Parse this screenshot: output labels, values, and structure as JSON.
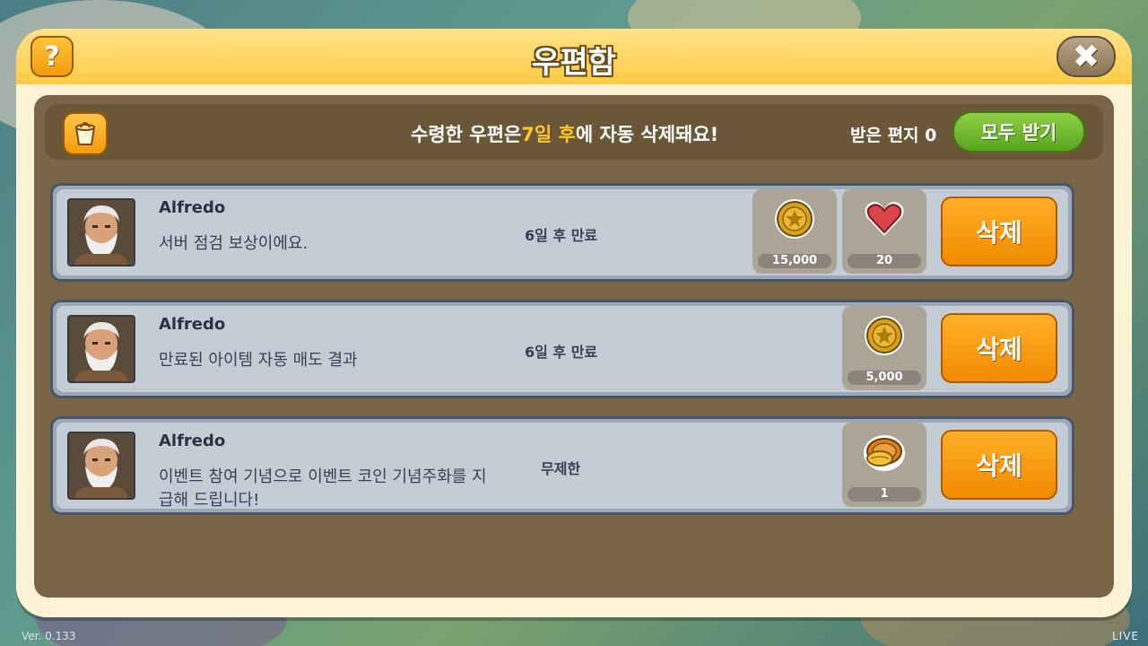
{
  "app": {
    "version": "Ver. 0.133",
    "live": "LIVE"
  },
  "dialog": {
    "title": "우편함",
    "help_icon": "?",
    "close_icon": "✖"
  },
  "notice": {
    "text_before": "수령한 우편은",
    "text_highlight": "7일 후",
    "text_after": "에 자동 삭제돼요!",
    "received_label": "받은 편지 0",
    "receive_all_label": "모두 받기"
  },
  "mails": [
    {
      "sender": "Alfredo",
      "message": "서버 점검 보상이에요.",
      "expire": "6일 후 만료",
      "rewards": [
        {
          "icon": "gold-coin-icon",
          "qty": "15,000"
        },
        {
          "icon": "heart-icon",
          "qty": "20"
        }
      ],
      "delete_label": "삭제"
    },
    {
      "sender": "Alfredo",
      "message": "만료된 아이템 자동 매도 결과",
      "expire": "6일 후 만료",
      "rewards": [
        {
          "icon": "gold-coin-icon",
          "qty": "5,000"
        }
      ],
      "delete_label": "삭제"
    },
    {
      "sender": "Alfredo",
      "message": "이벤트 참여 기념으로 이벤트 코인 기념주화를 지급해 드립니다!",
      "expire": "무제한",
      "rewards": [
        {
          "icon": "event-coin-icon",
          "qty": "1"
        }
      ],
      "delete_label": "삭제"
    }
  ],
  "colors": {
    "header": "#ffcb45",
    "body": "#7a6646",
    "accent": "#ffc629",
    "delete": "#f18a00",
    "receive_all": "#5aa51f"
  }
}
